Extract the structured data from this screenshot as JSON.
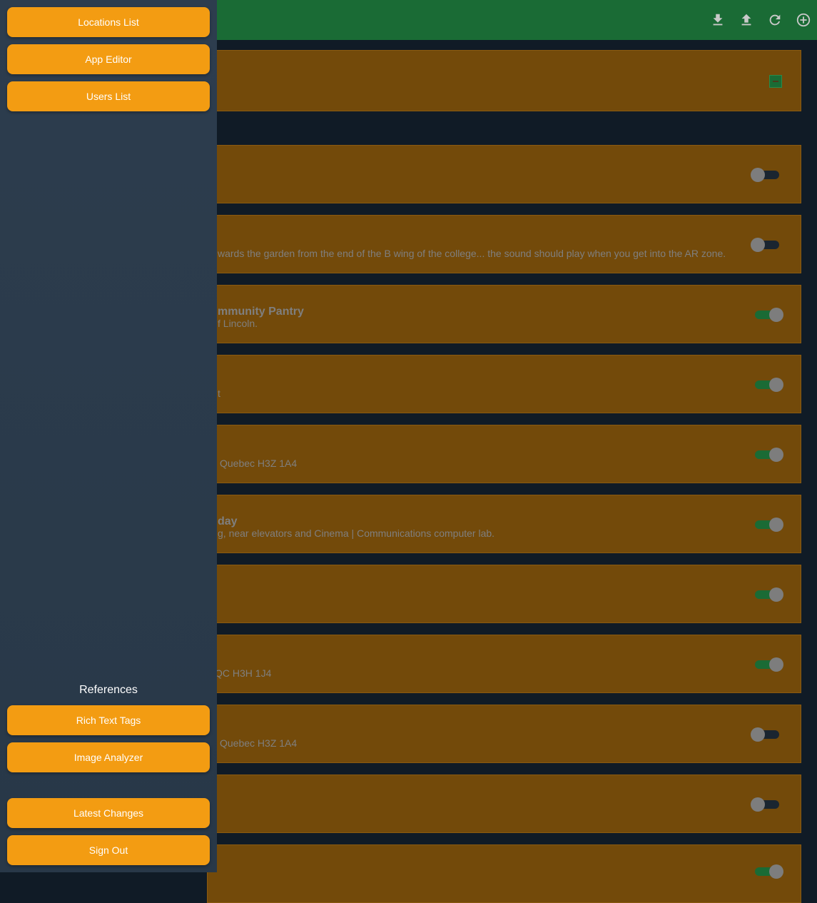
{
  "colors": {
    "accent": "#f39c12",
    "topbar": "#1a6b35",
    "card": "#734a0a",
    "sidebar": "#2d3d4e"
  },
  "toolbar": {
    "icons": [
      "download-icon",
      "upload-icon",
      "refresh-icon",
      "add-circle-icon"
    ]
  },
  "sidebar": {
    "nav": [
      "Locations List",
      "App Editor",
      "Users List"
    ],
    "references_heading": "References",
    "references": [
      "Rich Text Tags",
      "Image Analyzer"
    ],
    "footer": [
      "Latest Changes",
      "Sign Out"
    ]
  },
  "cards": [
    {
      "title": "",
      "subtitle": "",
      "enabled": false
    },
    {
      "title": "",
      "subtitle": "wards the garden from the end of the B wing of the college... the sound should play when you get into the AR zone.",
      "enabled": false
    },
    {
      "title": "mmunity Pantry",
      "subtitle": "f Lincoln.",
      "enabled": true
    },
    {
      "title": "",
      "subtitle": "t",
      "enabled": true
    },
    {
      "title": "",
      "subtitle": "Quebec H3Z 1A4",
      "enabled": true
    },
    {
      "title": "day",
      "subtitle": "g, near elevators and Cinema | Communications computer lab.",
      "enabled": true
    },
    {
      "title": "",
      "subtitle": "",
      "enabled": true
    },
    {
      "title": "",
      "subtitle": "QC H3H 1J4",
      "enabled": true
    },
    {
      "title": "",
      "subtitle": "Quebec H3Z 1A4",
      "enabled": false
    },
    {
      "title": "",
      "subtitle": "",
      "enabled": false
    },
    {
      "title": "",
      "subtitle": "",
      "enabled": true
    }
  ]
}
